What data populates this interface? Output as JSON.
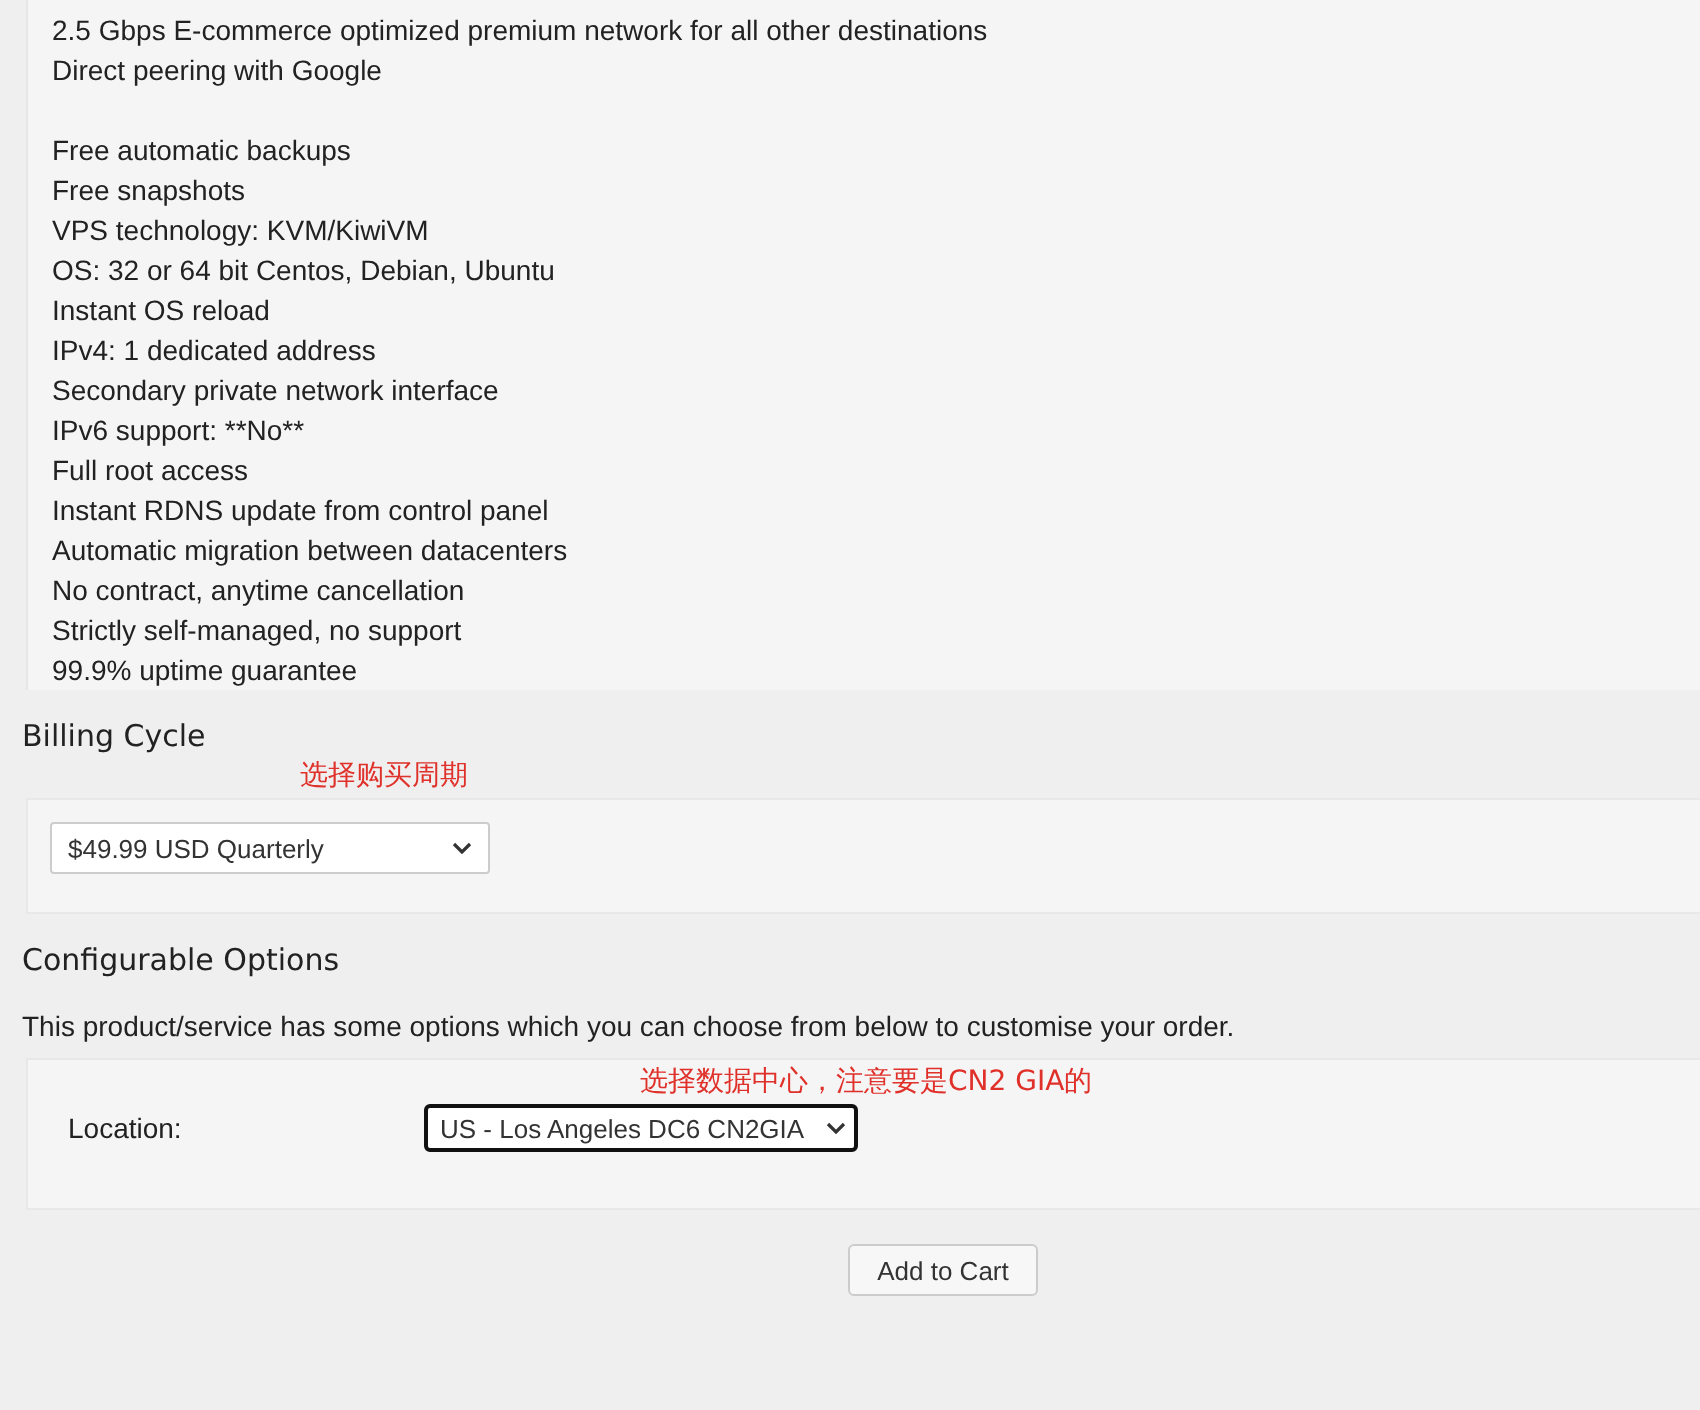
{
  "features": [
    [
      "2.5 Gbps E-commerce optimized premium network for all other destinations",
      "Direct peering with Google"
    ],
    [
      "Free automatic backups",
      "Free snapshots",
      "VPS technology: KVM/KiwiVM",
      "OS: 32 or 64 bit Centos, Debian, Ubuntu",
      "Instant OS reload",
      "IPv4: 1 dedicated address",
      "Secondary private network interface",
      "IPv6 support: **No**",
      "Full root access",
      "Instant RDNS update from control panel",
      "Automatic migration between datacenters",
      "No contract, anytime cancellation",
      "Strictly self-managed, no support",
      "99.9% uptime guarantee"
    ]
  ],
  "billing": {
    "heading": "Billing Cycle",
    "annotation": "选择购买周期",
    "select": {
      "value": "$49.99 USD Quarterly",
      "focused": false
    }
  },
  "config": {
    "heading": "Configurable Options",
    "description": "This product/service has some options which you can choose from below to customise your order.",
    "annotation": "选择数据中心，注意要是CN2 GIA的",
    "options": [
      {
        "label": "Location:",
        "value": "US - Los Angeles DC6 CN2GIA",
        "focused": true
      }
    ]
  },
  "button": "Add to Cart"
}
